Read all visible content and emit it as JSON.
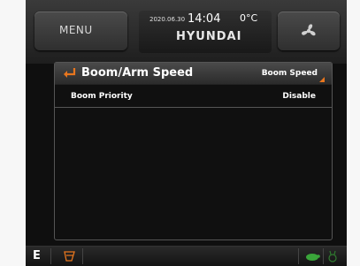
{
  "topbar": {
    "menu_label": "MENU",
    "date": "2020.06.30",
    "time": "14:04",
    "temperature": "0°C",
    "brand": "HYUNDAI",
    "fan_icon": "fan-icon"
  },
  "panel": {
    "title": "Boom/Arm Speed",
    "subtitle": "Boom Speed",
    "back_icon": "back-arrow-icon",
    "rows": [
      {
        "label": "Boom Priority",
        "value": "Disable"
      }
    ]
  },
  "bottombar": {
    "mode": "E",
    "icons": [
      "excavator-tool-icon",
      "turtle-icon",
      "rabbit-icon"
    ]
  },
  "colors": {
    "accent": "#e8761e",
    "text": "#ffffff",
    "status_green": "#3aa53a"
  }
}
